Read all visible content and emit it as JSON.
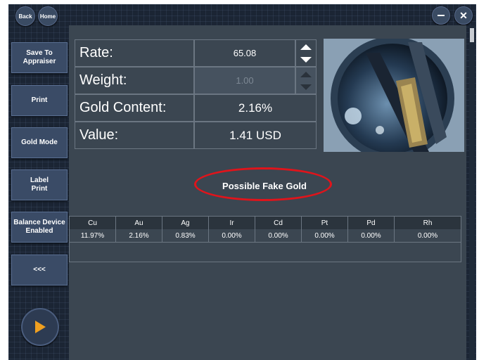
{
  "topbar": {
    "back_label": "Back",
    "home_label": "Home"
  },
  "sidebar": {
    "items": [
      {
        "label": "Save To\nAppraiser"
      },
      {
        "label": "Print"
      },
      {
        "label": "Gold Mode"
      },
      {
        "label": "Label\nPrint"
      },
      {
        "label": "Balance Device\nEnabled"
      },
      {
        "label": "<<<"
      }
    ]
  },
  "info": {
    "rate_label": "Rate:",
    "rate_value": "65.08",
    "weight_label": "Weight:",
    "weight_value": "1.00",
    "gold_label": "Gold Content:",
    "gold_value": "2.16%",
    "value_label": "Value:",
    "value_value": "1.41 USD"
  },
  "alert": {
    "text": "Possible Fake Gold",
    "ring_color": "#e0141b"
  },
  "composition": {
    "headers": [
      "Cu",
      "Au",
      "Ag",
      "Ir",
      "Cd",
      "Pt",
      "Pd",
      "Rh"
    ],
    "values": [
      "11.97%",
      "2.16%",
      "0.83%",
      "0.00%",
      "0.00%",
      "0.00%",
      "0.00%",
      "0.00%"
    ]
  },
  "colors": {
    "accent": "#f0a020",
    "panel": "#3b4651",
    "background": "#1b2534"
  }
}
